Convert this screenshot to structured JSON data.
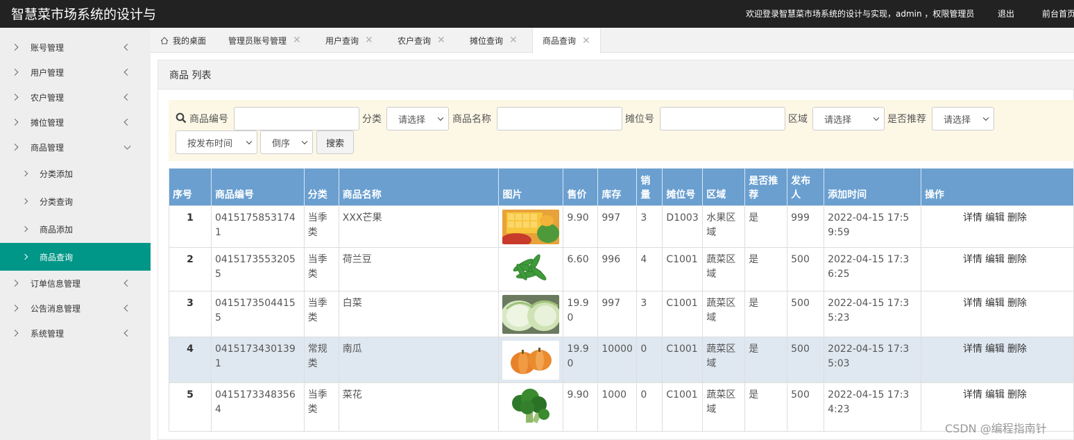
{
  "topbar": {
    "brand": "智慧菜市场系统的设计与",
    "welcome": "欢迎登录智慧菜市场系统的设计与实现，admin ，权限管理员",
    "logout": "退出",
    "front": "前台首页"
  },
  "sidebar": {
    "items": [
      {
        "label": "账号管理"
      },
      {
        "label": "用户管理"
      },
      {
        "label": "农户管理"
      },
      {
        "label": "摊位管理"
      },
      {
        "label": "商品管理"
      },
      {
        "label": "订单信息管理"
      },
      {
        "label": "公告消息管理"
      },
      {
        "label": "系统管理"
      }
    ],
    "sub_items": [
      {
        "label": "分类添加"
      },
      {
        "label": "分类查询"
      },
      {
        "label": "商品添加"
      },
      {
        "label": "商品查询"
      }
    ]
  },
  "tabs": [
    {
      "label": "我的桌面"
    },
    {
      "label": "管理员账号管理",
      "close": "✕"
    },
    {
      "label": "用户查询",
      "close": "✕"
    },
    {
      "label": "农户查询",
      "close": "✕"
    },
    {
      "label": "摊位查询",
      "close": "✕"
    },
    {
      "label": "商品查询",
      "close": "✕"
    }
  ],
  "panel": {
    "title": "商品 列表"
  },
  "search": {
    "code_label": "商品编号",
    "category_label": "分类",
    "category_select": "请选择",
    "name_label": "商品名称",
    "stall_label": "摊位号",
    "area_label": "区域",
    "area_select": "请选择",
    "recommend_label": "是否推荐",
    "recommend_select": "请选择",
    "sort_select": "按发布时间",
    "order_select": "倒序",
    "search_button": "搜索"
  },
  "table": {
    "headers": [
      "序号",
      "商品编号",
      "分类",
      "商品名称",
      "图片",
      "售价",
      "库存",
      "销量",
      "摊位号",
      "区域",
      "是否推荐",
      "发布人",
      "添加时间",
      "操作"
    ],
    "ops": [
      "详情",
      "编辑",
      "删除"
    ],
    "rows": [
      {
        "seq": "1",
        "code": "04151758531741",
        "category": "当季类",
        "name": "XXX芒果",
        "image": "mango",
        "price": "9.90",
        "stock": "997",
        "sales": "3",
        "stall": "D1003",
        "area": "水果区域",
        "recommend": "是",
        "publisher": "999",
        "time": "2022-04-15 17:59:59"
      },
      {
        "seq": "2",
        "code": "04151735532055",
        "category": "当季类",
        "name": "荷兰豆",
        "image": "snow-peas",
        "price": "6.60",
        "stock": "996",
        "sales": "4",
        "stall": "C1001",
        "area": "蔬菜区域",
        "recommend": "是",
        "publisher": "500",
        "time": "2022-04-15 17:36:25"
      },
      {
        "seq": "3",
        "code": "04151735044155",
        "category": "当季类",
        "name": "白菜",
        "image": "cabbage",
        "price": "19.90",
        "stock": "997",
        "sales": "3",
        "stall": "C1001",
        "area": "蔬菜区域",
        "recommend": "是",
        "publisher": "500",
        "time": "2022-04-15 17:35:23"
      },
      {
        "seq": "4",
        "code": "04151734301391",
        "category": "常规类",
        "name": "南瓜",
        "image": "pumpkin",
        "price": "19.90",
        "stock": "10000",
        "sales": "0",
        "stall": "C1001",
        "area": "蔬菜区域",
        "recommend": "是",
        "publisher": "500",
        "time": "2022-04-15 17:35:03"
      },
      {
        "seq": "5",
        "code": "04151733483564",
        "category": "当季类",
        "name": "菜花",
        "image": "broccoli",
        "price": "9.90",
        "stock": "1000",
        "sales": "0",
        "stall": "C1001",
        "area": "蔬菜区域",
        "recommend": "是",
        "publisher": "500",
        "time": "2022-04-15 17:34:23"
      }
    ]
  },
  "watermark": "CSDN @编程指南针"
}
